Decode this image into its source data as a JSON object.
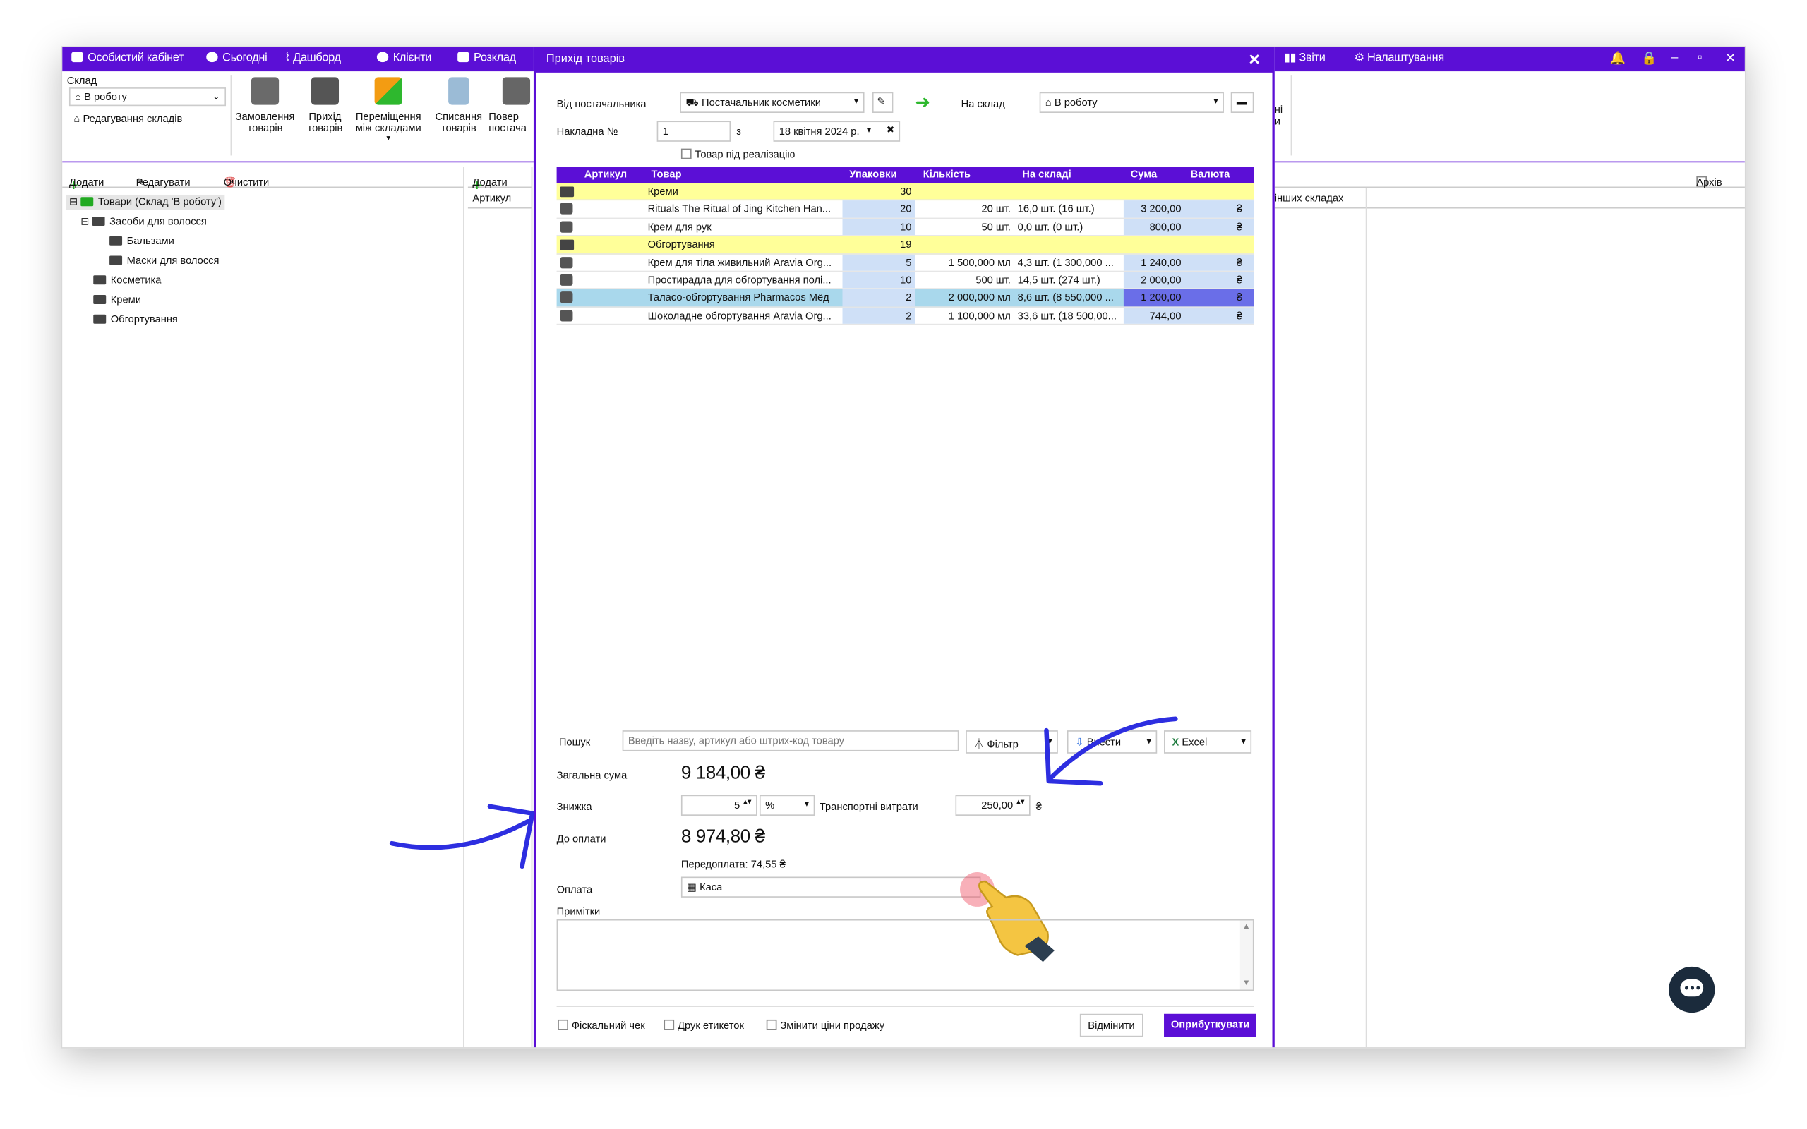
{
  "topnav": {
    "cabinet": "Особистий кабінет",
    "today": "Сьогодні",
    "dashboard": "Дашборд",
    "clients": "Клієнти",
    "schedule": "Розклад",
    "reports": "Звіти",
    "settings": "Налаштування"
  },
  "ribbon": {
    "warehouse_label": "Склад",
    "warehouse_value": "В роботу",
    "edit_warehouses": "Редагування складів",
    "btn_order_1": "Замовлення",
    "btn_order_2": "товарів",
    "btn_income_1": "Прихід",
    "btn_income_2": "товарів",
    "btn_move_1": "Переміщення",
    "btn_move_2": "між складами",
    "btn_writeoff_1": "Списання",
    "btn_writeoff_2": "товарів",
    "btn_return_1": "Повер",
    "btn_return_2": "постача",
    "right_frag_1": "ні",
    "right_frag_2": "и"
  },
  "left_panel": {
    "add": "Додати",
    "edit": "Редагувати",
    "clear": "Очистити",
    "tree": [
      "Товари (Склад 'В роботу')",
      "Засоби для волосся",
      "Бальзами",
      "Маски для волосся",
      "Косметика",
      "Креми",
      "Обгортування"
    ]
  },
  "middle_panel": {
    "add": "Додати",
    "col_article": "Артикул"
  },
  "right_panel": {
    "archive": "Архів",
    "col_other": "інших складах"
  },
  "dialog": {
    "title": "Прихід товарів",
    "from_supplier_label": "Від постачальника",
    "supplier_value": "Постачальник косметики",
    "to_warehouse_label": "На склад",
    "to_warehouse_value": "В роботу",
    "invoice_label": "Накладна  №",
    "invoice_number": "1",
    "from_label": "з",
    "invoice_date": "18 квітня 2024 р.",
    "consignment_label": "Товар під реалізацію",
    "columns": [
      "Артикул",
      "Товар",
      "Упаковки",
      "Кількість",
      "На складі",
      "Сума",
      "Валюта"
    ],
    "rows": [
      {
        "type": "folder",
        "product": "Креми",
        "packs": "30",
        "qty": "",
        "stock": "",
        "sum": "",
        "cur": ""
      },
      {
        "type": "item",
        "product": "Rituals The Ritual of Jing Kitchen Han...",
        "packs": "20",
        "qty": "20 шт.",
        "stock": "16,0 шт. (16 шт.)",
        "sum": "3 200,00",
        "cur": "₴"
      },
      {
        "type": "item",
        "product": "Крем для рук",
        "packs": "10",
        "qty": "50 шт.",
        "stock": "0,0 шт. (0 шт.)",
        "sum": "800,00",
        "cur": "₴"
      },
      {
        "type": "folder",
        "product": "Обгортування",
        "packs": "19",
        "qty": "",
        "stock": "",
        "sum": "",
        "cur": ""
      },
      {
        "type": "item",
        "product": "Крем для тіла живильний Aravia Org...",
        "packs": "5",
        "qty": "1 500,000 мл",
        "stock": "4,3 шт. (1 300,000 ...",
        "sum": "1 240,00",
        "cur": "₴"
      },
      {
        "type": "item",
        "product": "Простирадла для обгортування полі...",
        "packs": "10",
        "qty": "500 шт.",
        "stock": "14,5 шт. (274 шт.)",
        "sum": "2 000,00",
        "cur": "₴"
      },
      {
        "type": "sel",
        "product": "Таласо-обгортування Pharmacos Mёд",
        "packs": "2",
        "qty": "2 000,000 мл",
        "stock": "8,6 шт. (8 550,000 ...",
        "sum": "1 200,00",
        "cur": "₴"
      },
      {
        "type": "item",
        "product": "Шоколадне обгортування Aravia Org...",
        "packs": "2",
        "qty": "1 100,000 мл",
        "stock": "33,6 шт. (18 500,00...",
        "sum": "744,00",
        "cur": "₴"
      }
    ],
    "search_label": "Пошук",
    "search_placeholder": "Введіть назву, артикул або штрих-код товару",
    "filter_btn": "Фільтр",
    "import_btn": "Внести",
    "excel_btn": "Excel",
    "total_label": "Загальна сума",
    "total_value": "9 184,00 ₴",
    "discount_label": "Знижка",
    "discount_value": "5",
    "discount_unit": "%",
    "transport_label": "Транспортні витрати",
    "transport_value": "250,00",
    "currency": "₴",
    "to_pay_label": "До оплати",
    "to_pay_value": "8 974,80 ₴",
    "overpay": "Передоплата: 74,55 ₴",
    "payment_label": "Оплата",
    "payment_value": "Каса",
    "notes_label": "Примітки",
    "fiscal_check": "Фіскальний чек",
    "print_labels": "Друк етикеток",
    "change_prices": "Змінити ціни продажу",
    "cancel_btn": "Відмінити",
    "submit_btn": "Оприбуткувати"
  }
}
